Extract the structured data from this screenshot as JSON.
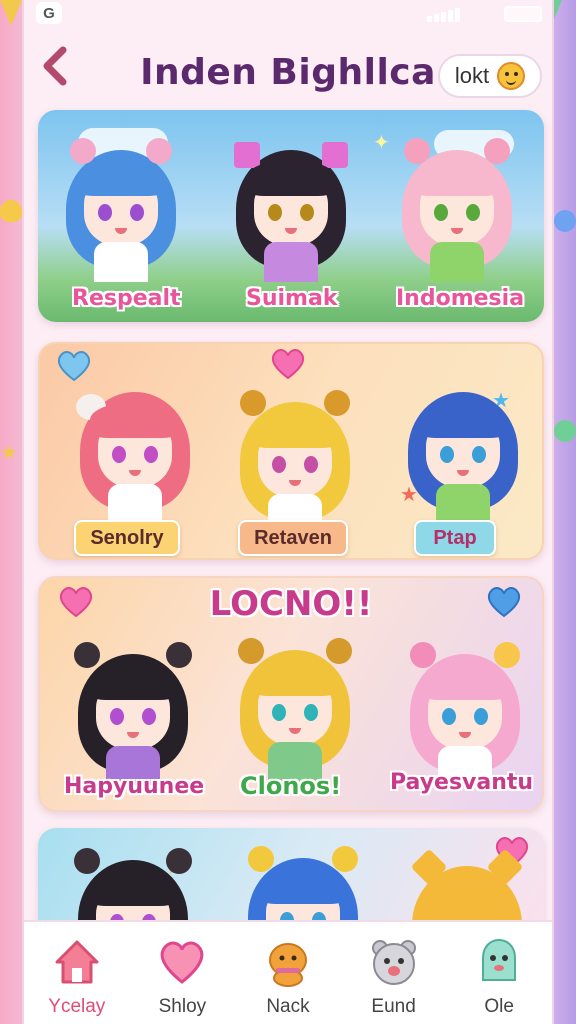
{
  "status_bar": {
    "app_letter": "G"
  },
  "header": {
    "title": "Inden Bighllca",
    "pill_label": "lokt"
  },
  "card1": {
    "characters": [
      {
        "name": "Respealt"
      },
      {
        "name": "Suimak"
      },
      {
        "name": "Indomesia"
      }
    ]
  },
  "card2": {
    "characters": [
      {
        "name": "Senolry"
      },
      {
        "name": "Retaven"
      },
      {
        "name": "Ptap"
      }
    ]
  },
  "card3": {
    "title": "LOCNO!!",
    "characters": [
      {
        "name": "Hapyuunee"
      },
      {
        "name": "Clonos!"
      },
      {
        "name": "Payesvantu"
      }
    ]
  },
  "bottom_nav": {
    "items": [
      {
        "label": "Ycelay",
        "icon": "home-icon"
      },
      {
        "label": "Shloy",
        "icon": "heart-icon"
      },
      {
        "label": "Nack",
        "icon": "cat-mascot-icon"
      },
      {
        "label": "Eund",
        "icon": "bear-icon"
      },
      {
        "label": "Ole",
        "icon": "ghost-mascot-icon"
      }
    ],
    "active_index": 0
  },
  "colors": {
    "accent": "#e04c76",
    "title": "#5b2a6e",
    "label_pink": "#e8559b"
  }
}
